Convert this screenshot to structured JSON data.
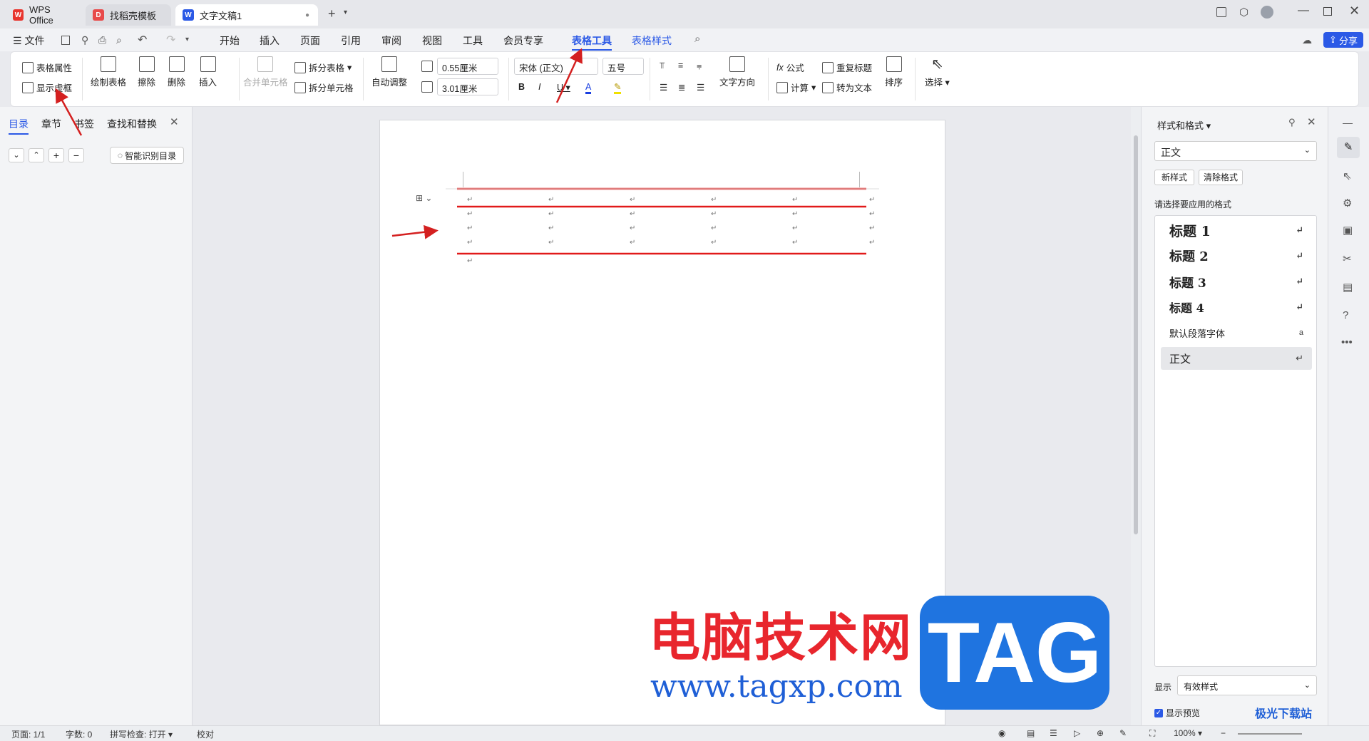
{
  "tabs": [
    {
      "label": "WPS Office",
      "logo": "W"
    },
    {
      "label": "找稻壳模板",
      "logo": "D"
    },
    {
      "label": "文字文稿1",
      "logo": "W"
    }
  ],
  "menu": {
    "file": "文件",
    "items": [
      "开始",
      "插入",
      "页面",
      "引用",
      "审阅",
      "视图",
      "工具",
      "会员专享",
      "表格工具",
      "表格样式"
    ],
    "share": "分享"
  },
  "ribbon": {
    "table_props": "表格属性",
    "show_gridlines": "显示虚框",
    "draw_table": "绘制表格",
    "eraser": "擦除",
    "delete": "删除",
    "insert": "插入",
    "merge_cells": "合并单元格",
    "split_table": "拆分表格",
    "split_cells": "拆分单元格",
    "auto_adjust": "自动调整",
    "row_height": "0.55厘米",
    "col_width": "3.01厘米",
    "font_name": "宋体 (正文)",
    "font_size": "五号",
    "text_direction": "文字方向",
    "formula": "公式",
    "calculate": "计算",
    "repeat_header": "重复标题",
    "convert_text": "转为文本",
    "sort": "排序",
    "select": "选择"
  },
  "left_panel": {
    "tabs": [
      "目录",
      "章节",
      "书签",
      "查找和替换"
    ],
    "smart_toc": "智能识别目录"
  },
  "right_panel": {
    "title": "样式和格式",
    "current_style": "正文",
    "new_style": "新样式",
    "clear_format": "清除格式",
    "prompt": "请选择要应用的格式",
    "styles": [
      "标题  1",
      "标题  2",
      "标题  3",
      "标题 4",
      "默认段落字体",
      "正文"
    ],
    "show_label": "显示",
    "show_value": "有效样式",
    "preview": "显示预览"
  },
  "status": {
    "page": "页面: 1/1",
    "words": "字数: 0",
    "spell": "拼写检查: 打开",
    "proof": "校对",
    "zoom": "100%"
  },
  "watermark": {
    "cn": "电脑技术网",
    "url": "www.tagxp.com",
    "tag": "TAG",
    "corner": "极光下载站"
  },
  "colors": {
    "accent": "#2b59e6",
    "table_line": "#e11a1a",
    "arrow": "#d42020",
    "tag_bg": "#1f74e0"
  }
}
